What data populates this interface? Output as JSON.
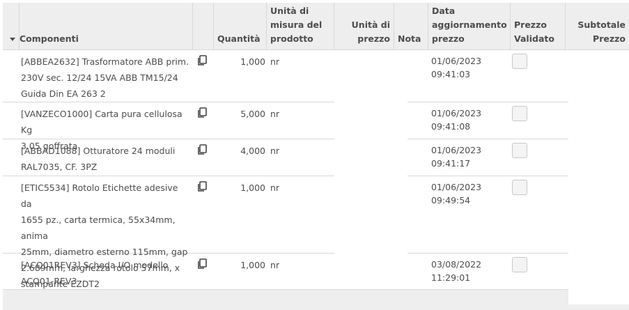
{
  "columns": {
    "components": "Componenti",
    "quantity": "Quantità",
    "uom_line1": "Unità di",
    "uom_line2": "misura del",
    "uom_line3": "prodotto",
    "price_unit_line1": "Unità di",
    "price_unit_line2": "prezzo",
    "note": "Nota",
    "date_line1": "Data",
    "date_line2": "aggiornamento",
    "date_line3": "prezzo",
    "validated_line1": "Prezzo",
    "validated_line2": "Validato",
    "subtotal_line1": "Subtotale",
    "subtotal_line2": "Prezzo"
  },
  "rows": [
    {
      "product_lines": [
        "[ABBEA2632] Trasformatore ABB prim.",
        "230V sec. 12/24 15VA ABB TM15/24",
        "Guida Din EA 263 2"
      ],
      "quantity": "1,000",
      "uom": "nr",
      "date": "01/06/2023",
      "time": "09:41:03",
      "validated": false
    },
    {
      "product_lines": [
        "[VANZECO1000] Carta pura cellulosa Kg",
        "3.05 goffrata"
      ],
      "quantity": "5,000",
      "uom": "nr",
      "date": "01/06/2023",
      "time": "09:41:08",
      "validated": false
    },
    {
      "product_lines": [
        "[ABBAD1088] Otturatore 24 moduli",
        "RAL7035, CF. 3PZ"
      ],
      "quantity": "4,000",
      "uom": "nr",
      "date": "01/06/2023",
      "time": "09:41:17",
      "validated": false
    },
    {
      "product_lines": [
        "[ETIC5534] Rotolo Etichette adesive da",
        "1655 pz., carta termica, 55x34mm, anima",
        "25mm, diametro esterno 115mm, gap",
        "2.689mm, larghezza rotolo 57mm, x",
        "stampante EZDT2"
      ],
      "quantity": "1,000",
      "uom": "nr",
      "date": "01/06/2023",
      "time": "09:49:54",
      "validated": false
    },
    {
      "product_lines": [
        "[ACQ01REV3] Scheda I/O modello",
        "ACQ01-REV3"
      ],
      "quantity": "1,000",
      "uom": "nr",
      "date": "03/08/2022",
      "time": "11:29:01",
      "validated": false
    }
  ],
  "icons": {
    "copy": "copy-icon",
    "sort": "caret-down-icon"
  }
}
